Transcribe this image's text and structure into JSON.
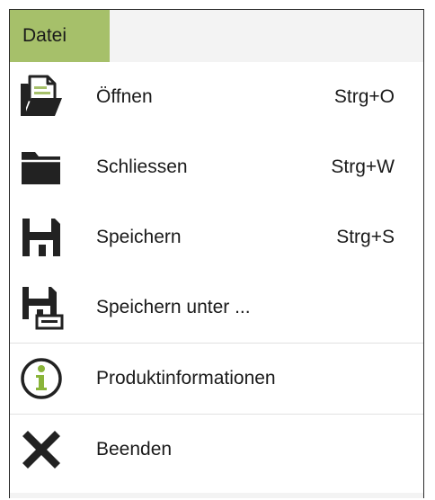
{
  "menu_tab": {
    "label": "Datei",
    "color": "#a6c06a"
  },
  "items": [
    {
      "label": "Öffnen",
      "shortcut": "Strg+O",
      "icon": "folder-open-document-icon"
    },
    {
      "label": "Schliessen",
      "shortcut": "Strg+W",
      "icon": "folder-closed-icon"
    },
    {
      "label": "Speichern",
      "shortcut": "Strg+S",
      "icon": "floppy-disk-icon"
    },
    {
      "label": "Speichern unter ...",
      "shortcut": "",
      "icon": "floppy-disk-save-as-icon"
    },
    {
      "label": "Produktinformationen",
      "shortcut": "",
      "icon": "info-circle-icon"
    },
    {
      "label": "Beenden",
      "shortcut": "",
      "icon": "close-x-icon"
    }
  ],
  "colors": {
    "icon_dark": "#222222",
    "info_green": "#8ab43a"
  }
}
